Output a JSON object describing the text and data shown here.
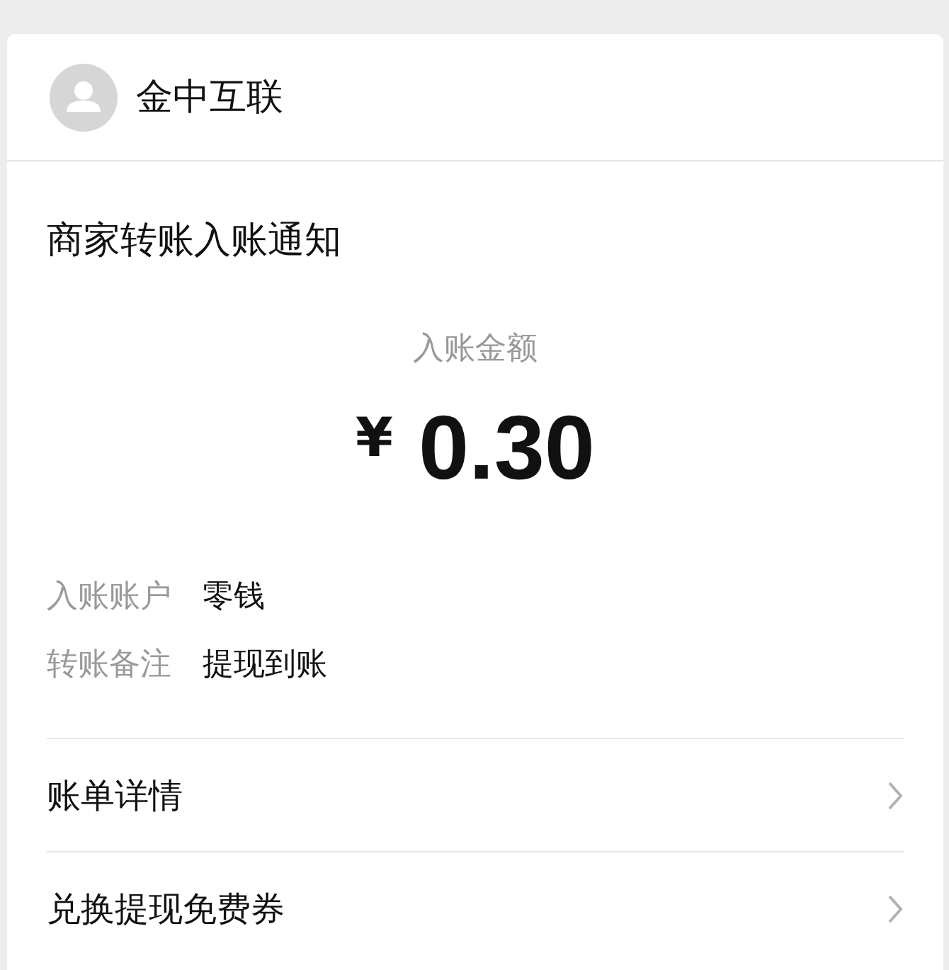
{
  "header": {
    "name": "金中互联"
  },
  "title": "商家转账入账通知",
  "amount": {
    "label": "入账金额",
    "currency": "¥",
    "value": "0.30"
  },
  "details": [
    {
      "label": "入账账户",
      "value": "零钱"
    },
    {
      "label": "转账备注",
      "value": "提现到账"
    }
  ],
  "links": [
    {
      "label": "账单详情"
    },
    {
      "label": "兑换提现免费券"
    }
  ]
}
